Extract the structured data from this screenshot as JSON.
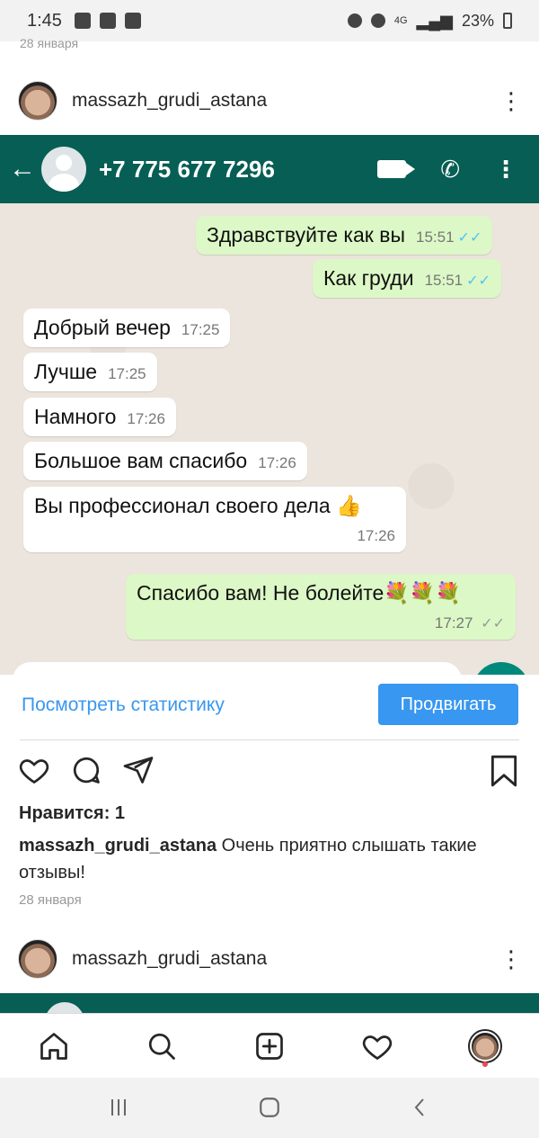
{
  "status_bar": {
    "time": "1:45",
    "network": "4G",
    "battery": "23%"
  },
  "top_date": "28 января",
  "post": {
    "username": "massazh_grudi_astana",
    "more": "⋮"
  },
  "whatsapp": {
    "back": "←",
    "phone": "+7 775 677 7296",
    "messages": [
      {
        "dir": "out",
        "text": "Здравствуйте как вы",
        "time": "15:51",
        "tick": "✓✓"
      },
      {
        "dir": "out",
        "text": "Как груди",
        "time": "15:51",
        "tick": "✓✓"
      },
      {
        "dir": "in",
        "text": "Добрый вечер",
        "time": "17:25"
      },
      {
        "dir": "in",
        "text": "Лучше",
        "time": "17:25"
      },
      {
        "dir": "in",
        "text": "Намного",
        "time": "17:26"
      },
      {
        "dir": "in",
        "text": "Большое вам спасибо",
        "time": "17:26"
      },
      {
        "dir": "in",
        "text": "Вы профессионал своего дела 👍",
        "time": "17:26"
      },
      {
        "dir": "out",
        "text": "Спасибо вам! Не болейте💐💐💐",
        "time": "17:27",
        "tick": "✓✓"
      }
    ]
  },
  "actions": {
    "stats_link": "Посмотреть статистику",
    "promote_button": "Продвигать"
  },
  "likes": "Нравится: 1",
  "caption": {
    "user": "massazh_grudi_astana",
    "text": " Очень приятно слышать такие отзывы!"
  },
  "post_date": "28 января",
  "next_post": {
    "username": "massazh_grudi_astana",
    "more": "⋮"
  },
  "icons": [
    "home-icon",
    "search-icon",
    "add-icon",
    "heart-icon",
    "profile-icon"
  ],
  "colors": {
    "whatsapp_bar": "#075e54",
    "outgoing_bubble": "#dcf8c6",
    "link_blue": "#3897f0"
  }
}
